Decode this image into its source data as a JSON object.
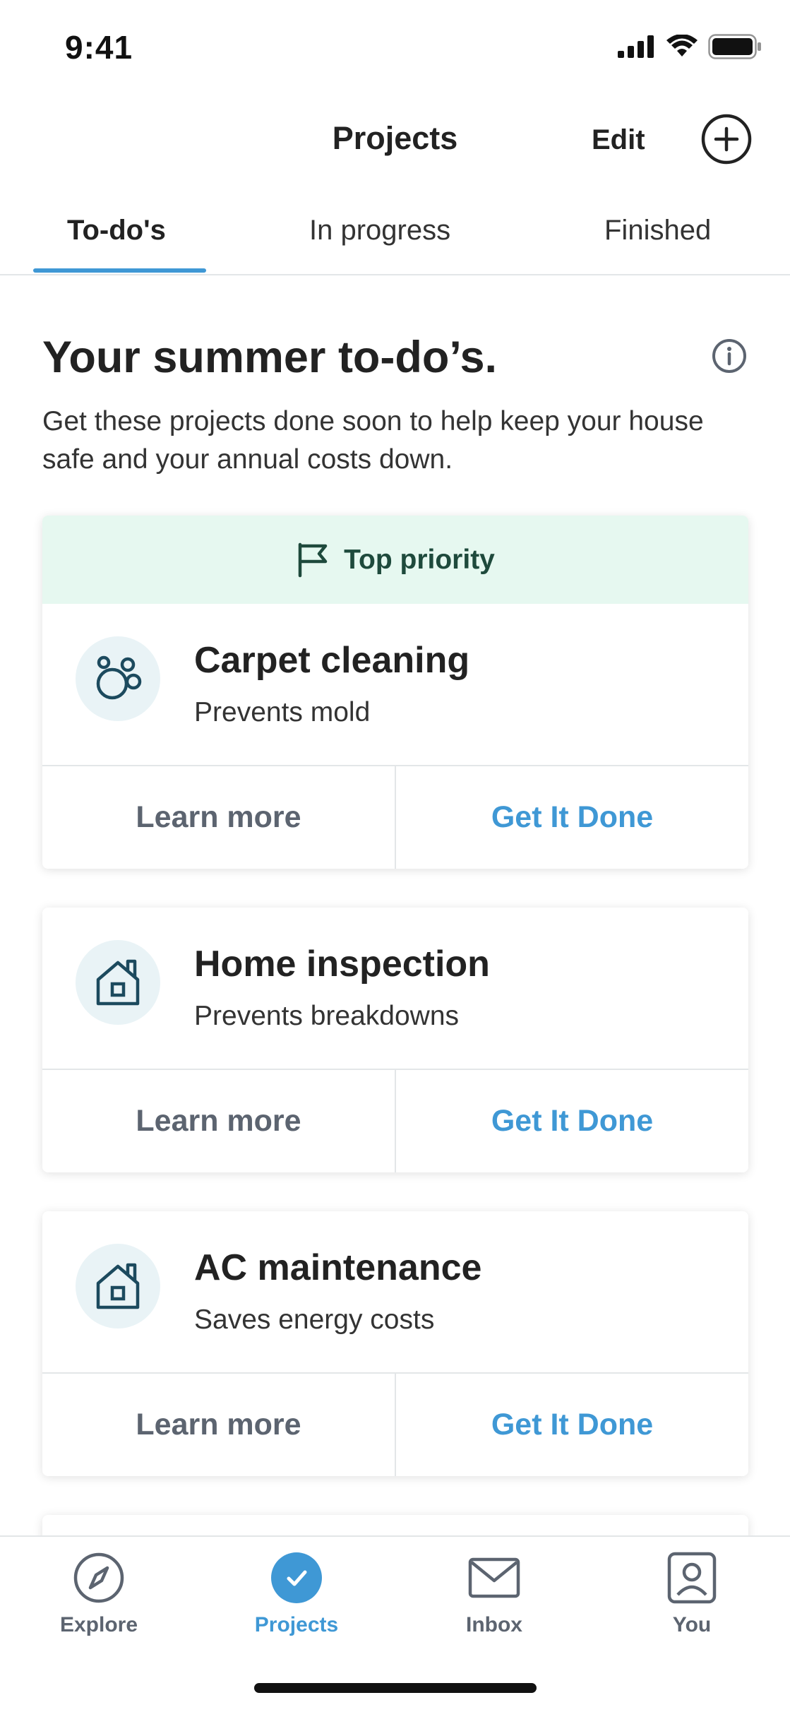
{
  "status_bar": {
    "time": "9:41"
  },
  "header": {
    "title": "Projects",
    "edit_label": "Edit"
  },
  "tabs": [
    {
      "label": "To-do's",
      "active": true
    },
    {
      "label": "In progress",
      "active": false
    },
    {
      "label": "Finished",
      "active": false
    }
  ],
  "intro": {
    "title": "Your summer to-do’s.",
    "description": "Get these projects done soon to help keep your house safe and your annual costs down."
  },
  "banner": {
    "label": "Top priority",
    "icon": "flag-icon"
  },
  "cards": [
    {
      "title": "Carpet cleaning",
      "subtitle": "Prevents mold",
      "icon": "bubbles-icon",
      "learn_label": "Learn more",
      "done_label": "Get It Done"
    },
    {
      "title": "Home inspection",
      "subtitle": "Prevents breakdowns",
      "icon": "house-icon",
      "learn_label": "Learn more",
      "done_label": "Get It Done"
    },
    {
      "title": "AC maintenance",
      "subtitle": "Saves energy costs",
      "icon": "house-icon",
      "learn_label": "Learn more",
      "done_label": "Get It Done"
    }
  ],
  "bottom_nav": [
    {
      "label": "Explore",
      "icon": "compass-icon",
      "active": false
    },
    {
      "label": "Projects",
      "icon": "checkmark-icon",
      "active": true
    },
    {
      "label": "Inbox",
      "icon": "envelope-icon",
      "active": false
    },
    {
      "label": "You",
      "icon": "profile-icon",
      "active": false
    }
  ],
  "colors": {
    "accent": "#3f98d5",
    "banner_bg": "#e6f8f0",
    "banner_text": "#1e4a3c",
    "icon_circle": "#e9f3f6"
  }
}
